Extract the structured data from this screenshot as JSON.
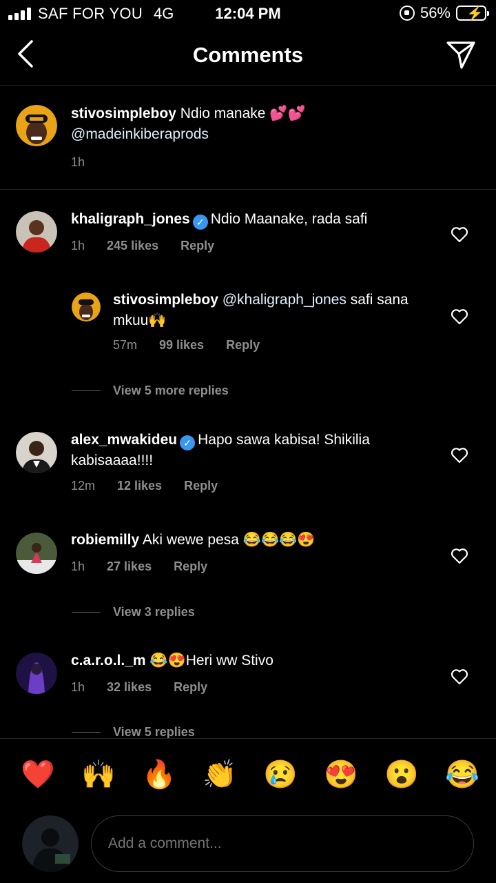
{
  "status": {
    "carrier": "SAF FOR YOU",
    "network": "4G",
    "time": "12:04 PM",
    "battery": "56%"
  },
  "header": {
    "title": "Comments"
  },
  "caption": {
    "user": "stivosimpleboy",
    "text": "Ndio manake 💕💕",
    "mention": "@madeinkiberaprods",
    "time": "1h"
  },
  "comments": [
    {
      "user": "khaligraph_jones",
      "verified": true,
      "text": "Ndio Maanake, rada safi",
      "time": "1h",
      "likes": "245 likes",
      "reply": "Reply"
    },
    {
      "user": "stivosimpleboy",
      "mention": "@khaligraph_jones",
      "text": "safi sana mkuu🙌",
      "time": "57m",
      "likes": "99 likes",
      "reply": "Reply"
    },
    {
      "user": "alex_mwakideu",
      "verified": true,
      "text": "Hapo sawa kabisa! Shikilia kabisaaaa!!!!",
      "time": "12m",
      "likes": "12 likes",
      "reply": "Reply"
    },
    {
      "user": "robiemilly",
      "text": "Aki wewe pesa 😂😂😂😍",
      "time": "1h",
      "likes": "27 likes",
      "reply": "Reply"
    },
    {
      "user": "c.a.r.o.l._m",
      "text": "😂😍Heri ww Stivo",
      "time": "1h",
      "likes": "32 likes",
      "reply": "Reply"
    }
  ],
  "view_replies": [
    "View 5 more replies",
    "View 3 replies",
    "View 5 replies"
  ],
  "emojis": [
    "❤️",
    "🙌",
    "🔥",
    "👏",
    "😢",
    "😍",
    "😮",
    "😂"
  ],
  "composer": {
    "placeholder": "Add a comment..."
  },
  "colors": {
    "accent": "#3897f0",
    "muted": "#8e8e8e",
    "background": "#000000"
  },
  "icons": [
    "back-chevron-icon",
    "send-paper-plane-icon",
    "heart-outline-icon",
    "verified-badge-icon"
  ]
}
